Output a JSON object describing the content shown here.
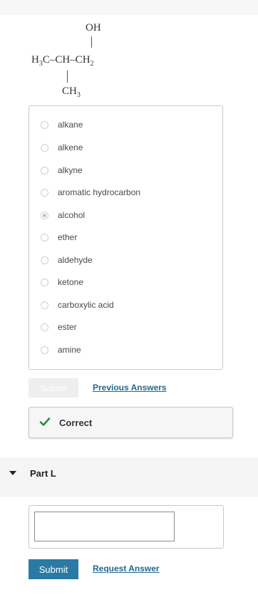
{
  "structure": {
    "oh": "OH",
    "main_chain_left": "H",
    "main_chain_sub3": "3",
    "main_chain_mid": "C–CH–CH",
    "main_chain_sub2": "2",
    "ch3_main": "CH",
    "ch3_sub": "3"
  },
  "options": [
    {
      "label": "alkane",
      "checked": false
    },
    {
      "label": "alkene",
      "checked": false
    },
    {
      "label": "alkyne",
      "checked": false
    },
    {
      "label": "aromatic hydrocarbon",
      "checked": false
    },
    {
      "label": "alcohol",
      "checked": true
    },
    {
      "label": "ether",
      "checked": false
    },
    {
      "label": "aldehyde",
      "checked": false
    },
    {
      "label": "ketone",
      "checked": false
    },
    {
      "label": "carboxylic acid",
      "checked": false
    },
    {
      "label": "ester",
      "checked": false
    },
    {
      "label": "amine",
      "checked": false
    }
  ],
  "part_k": {
    "submit_label": "Submit",
    "previous_answers_label": "Previous Answers",
    "feedback": "Correct"
  },
  "part_l": {
    "title": "Part L",
    "answer_value": "",
    "submit_label": "Submit",
    "request_answer_label": "Request Answer"
  },
  "colors": {
    "accent_button": "#2a7aa3",
    "link": "#1e6a8c",
    "correct_check": "#2e8b3a"
  }
}
